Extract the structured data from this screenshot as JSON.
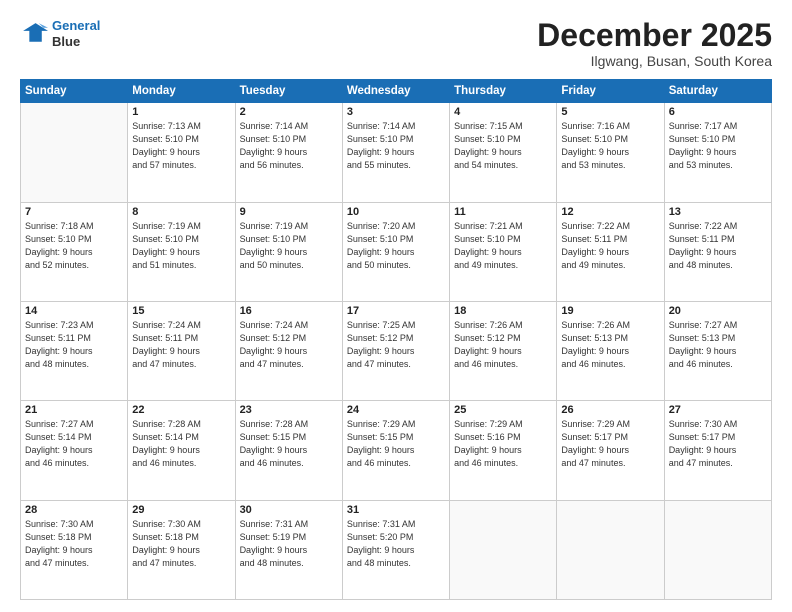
{
  "header": {
    "logo_line1": "General",
    "logo_line2": "Blue",
    "month": "December 2025",
    "location": "Ilgwang, Busan, South Korea"
  },
  "weekdays": [
    "Sunday",
    "Monday",
    "Tuesday",
    "Wednesday",
    "Thursday",
    "Friday",
    "Saturday"
  ],
  "weeks": [
    [
      {
        "day": "",
        "lines": []
      },
      {
        "day": "1",
        "lines": [
          "Sunrise: 7:13 AM",
          "Sunset: 5:10 PM",
          "Daylight: 9 hours",
          "and 57 minutes."
        ]
      },
      {
        "day": "2",
        "lines": [
          "Sunrise: 7:14 AM",
          "Sunset: 5:10 PM",
          "Daylight: 9 hours",
          "and 56 minutes."
        ]
      },
      {
        "day": "3",
        "lines": [
          "Sunrise: 7:14 AM",
          "Sunset: 5:10 PM",
          "Daylight: 9 hours",
          "and 55 minutes."
        ]
      },
      {
        "day": "4",
        "lines": [
          "Sunrise: 7:15 AM",
          "Sunset: 5:10 PM",
          "Daylight: 9 hours",
          "and 54 minutes."
        ]
      },
      {
        "day": "5",
        "lines": [
          "Sunrise: 7:16 AM",
          "Sunset: 5:10 PM",
          "Daylight: 9 hours",
          "and 53 minutes."
        ]
      },
      {
        "day": "6",
        "lines": [
          "Sunrise: 7:17 AM",
          "Sunset: 5:10 PM",
          "Daylight: 9 hours",
          "and 53 minutes."
        ]
      }
    ],
    [
      {
        "day": "7",
        "lines": [
          "Sunrise: 7:18 AM",
          "Sunset: 5:10 PM",
          "Daylight: 9 hours",
          "and 52 minutes."
        ]
      },
      {
        "day": "8",
        "lines": [
          "Sunrise: 7:19 AM",
          "Sunset: 5:10 PM",
          "Daylight: 9 hours",
          "and 51 minutes."
        ]
      },
      {
        "day": "9",
        "lines": [
          "Sunrise: 7:19 AM",
          "Sunset: 5:10 PM",
          "Daylight: 9 hours",
          "and 50 minutes."
        ]
      },
      {
        "day": "10",
        "lines": [
          "Sunrise: 7:20 AM",
          "Sunset: 5:10 PM",
          "Daylight: 9 hours",
          "and 50 minutes."
        ]
      },
      {
        "day": "11",
        "lines": [
          "Sunrise: 7:21 AM",
          "Sunset: 5:10 PM",
          "Daylight: 9 hours",
          "and 49 minutes."
        ]
      },
      {
        "day": "12",
        "lines": [
          "Sunrise: 7:22 AM",
          "Sunset: 5:11 PM",
          "Daylight: 9 hours",
          "and 49 minutes."
        ]
      },
      {
        "day": "13",
        "lines": [
          "Sunrise: 7:22 AM",
          "Sunset: 5:11 PM",
          "Daylight: 9 hours",
          "and 48 minutes."
        ]
      }
    ],
    [
      {
        "day": "14",
        "lines": [
          "Sunrise: 7:23 AM",
          "Sunset: 5:11 PM",
          "Daylight: 9 hours",
          "and 48 minutes."
        ]
      },
      {
        "day": "15",
        "lines": [
          "Sunrise: 7:24 AM",
          "Sunset: 5:11 PM",
          "Daylight: 9 hours",
          "and 47 minutes."
        ]
      },
      {
        "day": "16",
        "lines": [
          "Sunrise: 7:24 AM",
          "Sunset: 5:12 PM",
          "Daylight: 9 hours",
          "and 47 minutes."
        ]
      },
      {
        "day": "17",
        "lines": [
          "Sunrise: 7:25 AM",
          "Sunset: 5:12 PM",
          "Daylight: 9 hours",
          "and 47 minutes."
        ]
      },
      {
        "day": "18",
        "lines": [
          "Sunrise: 7:26 AM",
          "Sunset: 5:12 PM",
          "Daylight: 9 hours",
          "and 46 minutes."
        ]
      },
      {
        "day": "19",
        "lines": [
          "Sunrise: 7:26 AM",
          "Sunset: 5:13 PM",
          "Daylight: 9 hours",
          "and 46 minutes."
        ]
      },
      {
        "day": "20",
        "lines": [
          "Sunrise: 7:27 AM",
          "Sunset: 5:13 PM",
          "Daylight: 9 hours",
          "and 46 minutes."
        ]
      }
    ],
    [
      {
        "day": "21",
        "lines": [
          "Sunrise: 7:27 AM",
          "Sunset: 5:14 PM",
          "Daylight: 9 hours",
          "and 46 minutes."
        ]
      },
      {
        "day": "22",
        "lines": [
          "Sunrise: 7:28 AM",
          "Sunset: 5:14 PM",
          "Daylight: 9 hours",
          "and 46 minutes."
        ]
      },
      {
        "day": "23",
        "lines": [
          "Sunrise: 7:28 AM",
          "Sunset: 5:15 PM",
          "Daylight: 9 hours",
          "and 46 minutes."
        ]
      },
      {
        "day": "24",
        "lines": [
          "Sunrise: 7:29 AM",
          "Sunset: 5:15 PM",
          "Daylight: 9 hours",
          "and 46 minutes."
        ]
      },
      {
        "day": "25",
        "lines": [
          "Sunrise: 7:29 AM",
          "Sunset: 5:16 PM",
          "Daylight: 9 hours",
          "and 46 minutes."
        ]
      },
      {
        "day": "26",
        "lines": [
          "Sunrise: 7:29 AM",
          "Sunset: 5:17 PM",
          "Daylight: 9 hours",
          "and 47 minutes."
        ]
      },
      {
        "day": "27",
        "lines": [
          "Sunrise: 7:30 AM",
          "Sunset: 5:17 PM",
          "Daylight: 9 hours",
          "and 47 minutes."
        ]
      }
    ],
    [
      {
        "day": "28",
        "lines": [
          "Sunrise: 7:30 AM",
          "Sunset: 5:18 PM",
          "Daylight: 9 hours",
          "and 47 minutes."
        ]
      },
      {
        "day": "29",
        "lines": [
          "Sunrise: 7:30 AM",
          "Sunset: 5:18 PM",
          "Daylight: 9 hours",
          "and 47 minutes."
        ]
      },
      {
        "day": "30",
        "lines": [
          "Sunrise: 7:31 AM",
          "Sunset: 5:19 PM",
          "Daylight: 9 hours",
          "and 48 minutes."
        ]
      },
      {
        "day": "31",
        "lines": [
          "Sunrise: 7:31 AM",
          "Sunset: 5:20 PM",
          "Daylight: 9 hours",
          "and 48 minutes."
        ]
      },
      {
        "day": "",
        "lines": []
      },
      {
        "day": "",
        "lines": []
      },
      {
        "day": "",
        "lines": []
      }
    ]
  ]
}
